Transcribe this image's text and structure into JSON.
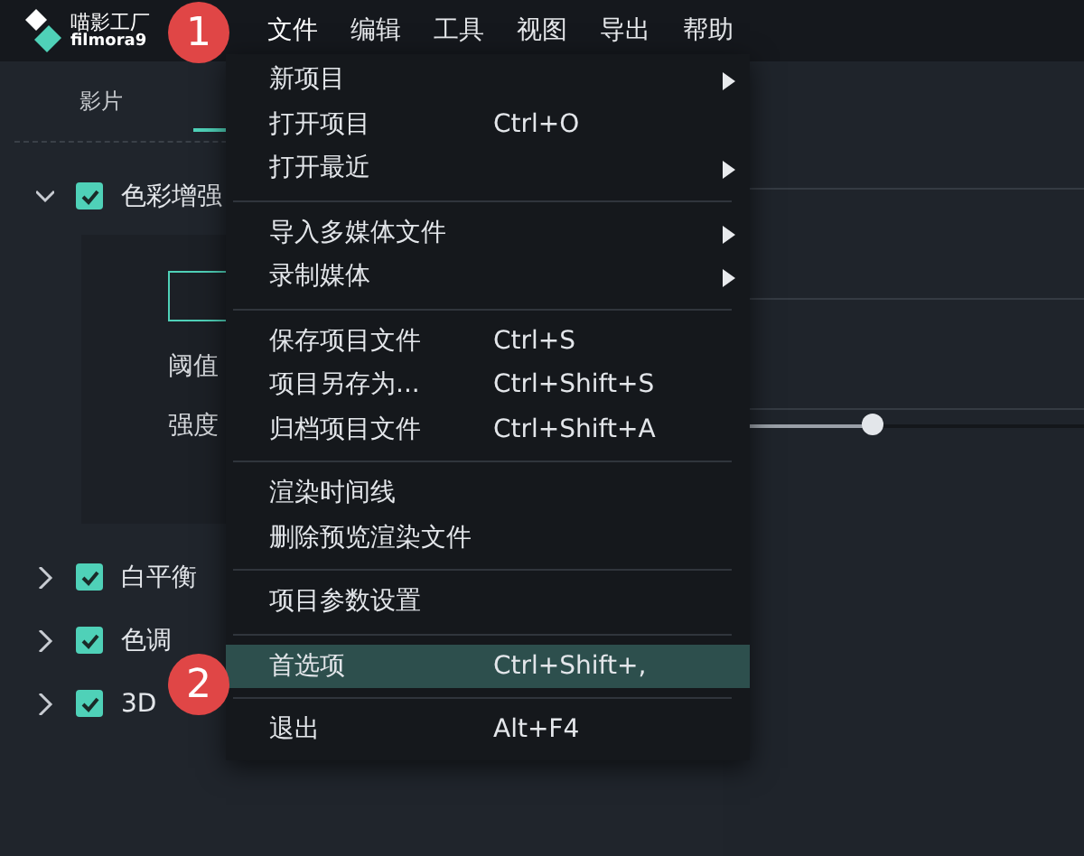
{
  "app": {
    "name": "喵影工厂",
    "subtitle": "filmora9"
  },
  "menubar": [
    {
      "label": "文件",
      "selected": true
    },
    {
      "label": "编辑",
      "selected": false
    },
    {
      "label": "工具",
      "selected": false
    },
    {
      "label": "视图",
      "selected": false
    },
    {
      "label": "导出",
      "selected": false
    },
    {
      "label": "帮助",
      "selected": false
    }
  ],
  "tabs": [
    {
      "label": "影片",
      "selected": false
    }
  ],
  "sections": [
    {
      "label": "色彩增强",
      "expanded": true,
      "checked": true
    },
    {
      "label": "白平衡",
      "expanded": false,
      "checked": true
    },
    {
      "label": "色调",
      "expanded": false,
      "checked": true
    },
    {
      "label": "3D",
      "expanded": false,
      "checked": true
    }
  ],
  "controls": [
    {
      "label": "阈值"
    },
    {
      "label": "强度",
      "level": 0.72
    }
  ],
  "menu": [
    {
      "kind": "item",
      "label": "新项目",
      "submenu": true,
      "selected": false
    },
    {
      "kind": "item",
      "label": "打开项目",
      "shortcut": "Ctrl+O",
      "submenu": false,
      "selected": false
    },
    {
      "kind": "item",
      "label": "打开最近",
      "submenu": true,
      "selected": false
    },
    {
      "kind": "separator"
    },
    {
      "kind": "item",
      "label": "导入多媒体文件",
      "submenu": true,
      "selected": false
    },
    {
      "kind": "item",
      "label": "录制媒体",
      "submenu": true,
      "selected": false
    },
    {
      "kind": "separator"
    },
    {
      "kind": "item",
      "label": "保存项目文件",
      "shortcut": "Ctrl+S",
      "submenu": false,
      "selected": false
    },
    {
      "kind": "item",
      "label": "项目另存为...",
      "shortcut": "Ctrl+Shift+S",
      "submenu": false,
      "selected": false
    },
    {
      "kind": "item",
      "label": "归档项目文件",
      "shortcut": "Ctrl+Shift+A",
      "submenu": false,
      "selected": false
    },
    {
      "kind": "separator"
    },
    {
      "kind": "item",
      "label": "渲染时间线",
      "submenu": false,
      "selected": false
    },
    {
      "kind": "item",
      "label": "删除预览渲染文件",
      "submenu": false,
      "selected": false
    },
    {
      "kind": "separator"
    },
    {
      "kind": "item",
      "label": "项目参数设置",
      "submenu": false,
      "selected": false
    },
    {
      "kind": "separator"
    },
    {
      "kind": "item",
      "label": "首选项",
      "shortcut": "Ctrl+Shift+,",
      "submenu": false,
      "selected": true
    },
    {
      "kind": "separator"
    },
    {
      "kind": "item",
      "label": "退出",
      "shortcut": "Alt+F4",
      "submenu": false,
      "selected": false
    }
  ],
  "step_badges": [
    "1",
    "2"
  ]
}
